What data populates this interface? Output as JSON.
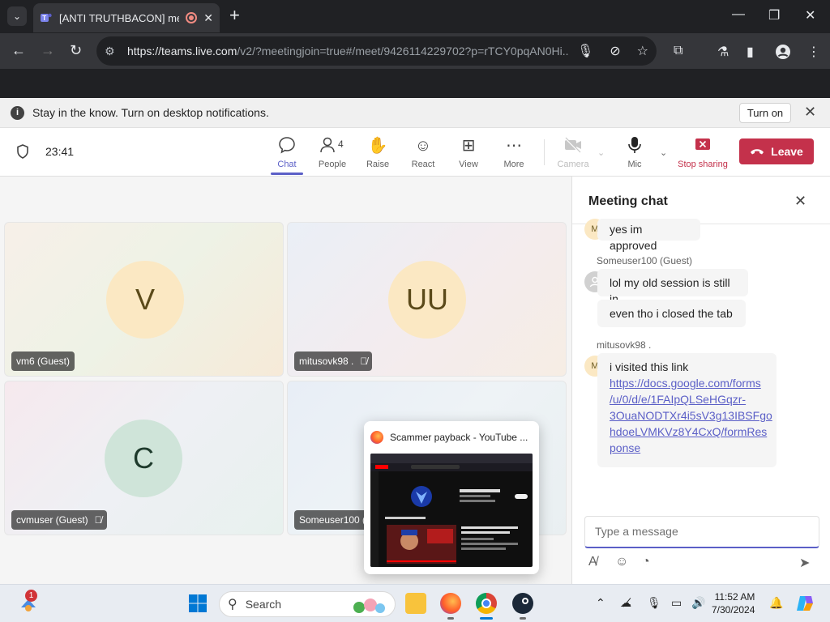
{
  "browser": {
    "tab_title": "[ANTI TRUTHBACON] mee",
    "url_host": "https://teams.live.com",
    "url_rest": "/v2/?meetingjoin=true#/meet/9426114229702?p=rTCY0pqAN0Hi...",
    "new_tab": "+",
    "min": "—",
    "restore": "❐",
    "close": "✕"
  },
  "notification": {
    "message": "Stay in the know. Turn on desktop notifications.",
    "action": "Turn on"
  },
  "controls": {
    "timer": "23:41",
    "chat": "Chat",
    "people": "People",
    "people_count": "4",
    "raise": "Raise",
    "react": "React",
    "view": "View",
    "more": "More",
    "camera": "Camera",
    "mic": "Mic",
    "stop_sharing": "Stop sharing",
    "leave": "Leave"
  },
  "participants": [
    {
      "initials": "V",
      "name": "vm6 (Guest)",
      "muted": false
    },
    {
      "initials": "UU",
      "name": "mitusovk98 .",
      "muted": true
    },
    {
      "initials": "C",
      "name": "cvmuser (Guest)",
      "muted": true
    },
    {
      "initials": "",
      "name": "Someuser100 (G",
      "muted": false
    }
  ],
  "chat": {
    "title": "Meeting chat",
    "messages": [
      {
        "avatar": "M",
        "text": "yes im approved"
      },
      {
        "sender": "Someuser100 (Guest)",
        "text": "lol my old session is still in"
      },
      {
        "text": "even tho i closed the tab"
      },
      {
        "sender": "mitusovk98 .",
        "avatar": "M",
        "text": "i visited this link"
      }
    ],
    "link_lines": [
      "https://docs.google.com/forms",
      "/u/0/d/e/1FAIpQLSeHGqzr-",
      "3OuaNODTXr4i5sV3g13IBSFgo",
      "hdoeLVMKVz8Y4CxQ/formRes",
      "ponse"
    ],
    "compose_placeholder": "Type a message"
  },
  "preview": {
    "title": "Scammer payback - YouTube ..."
  },
  "taskbar": {
    "search": "Search",
    "badge": "1",
    "time": "11:52 AM",
    "date": "7/30/2024"
  }
}
